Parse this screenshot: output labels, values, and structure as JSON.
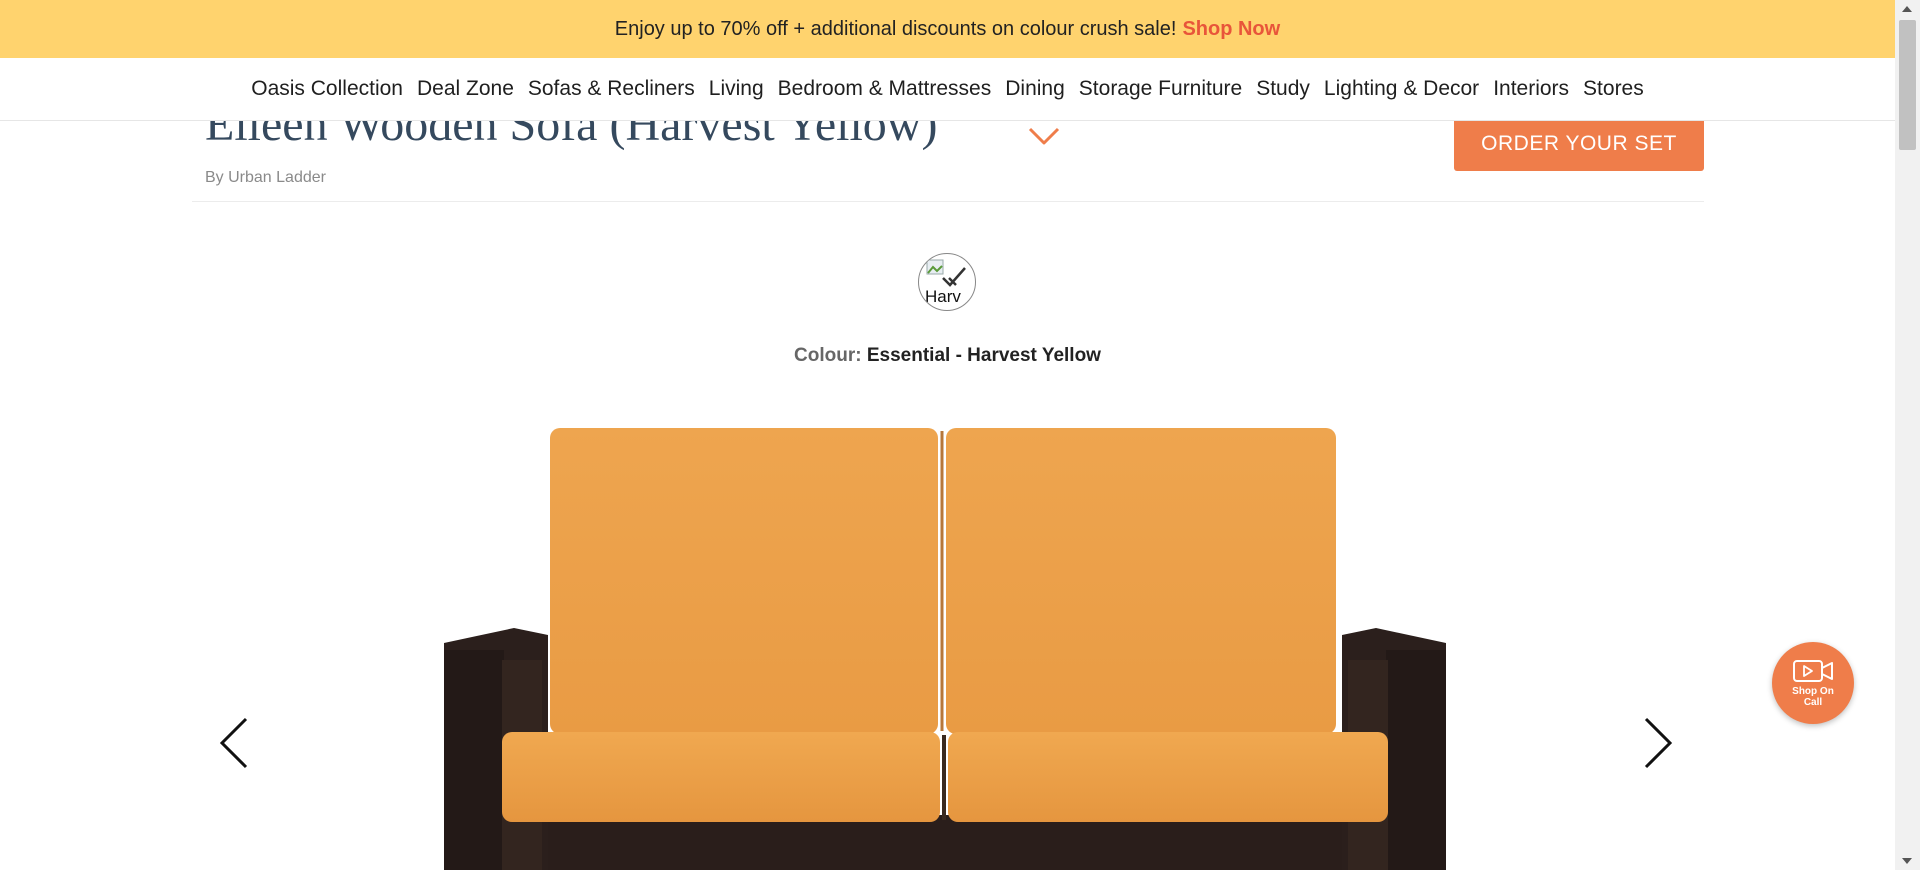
{
  "promo": {
    "text": "Enjoy up to 70% off + additional discounts on colour crush sale!",
    "link": "Shop Now"
  },
  "nav": {
    "items": [
      "Oasis Collection",
      "Deal Zone",
      "Sofas & Recliners",
      "Living",
      "Bedroom & Mattresses",
      "Dining",
      "Storage Furniture",
      "Study",
      "Lighting & Decor",
      "Interiors",
      "Stores"
    ]
  },
  "product": {
    "title": "Eileen Wooden Sofa (Harvest Yellow)",
    "brand": "By Urban Ladder",
    "order_button": "ORDER YOUR SET"
  },
  "swatch": {
    "text": "Harv"
  },
  "colour": {
    "label": "Colour:",
    "value": "Essential - Harvest Yellow"
  },
  "fab": {
    "label": "Shop On Call"
  },
  "colors": {
    "banner": "#ffd36e",
    "accent": "#ef7d4a",
    "title": "#35495e",
    "cushion": "#eea04a",
    "wood": "#2b1f1c"
  }
}
